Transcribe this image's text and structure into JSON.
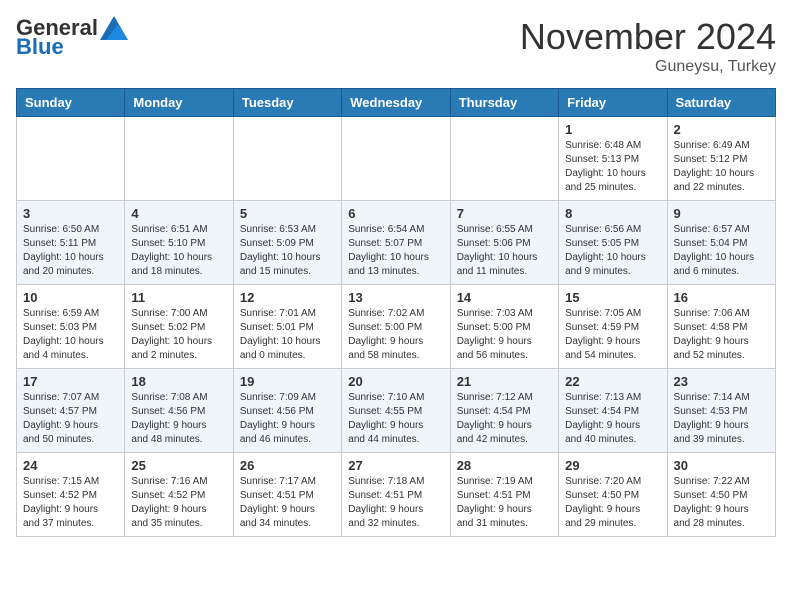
{
  "logo": {
    "general": "General",
    "blue": "Blue"
  },
  "header": {
    "title": "November 2024",
    "subtitle": "Guneysu, Turkey"
  },
  "weekdays": [
    "Sunday",
    "Monday",
    "Tuesday",
    "Wednesday",
    "Thursday",
    "Friday",
    "Saturday"
  ],
  "weeks": [
    [
      {
        "day": "",
        "info": ""
      },
      {
        "day": "",
        "info": ""
      },
      {
        "day": "",
        "info": ""
      },
      {
        "day": "",
        "info": ""
      },
      {
        "day": "",
        "info": ""
      },
      {
        "day": "1",
        "info": "Sunrise: 6:48 AM\nSunset: 5:13 PM\nDaylight: 10 hours\nand 25 minutes."
      },
      {
        "day": "2",
        "info": "Sunrise: 6:49 AM\nSunset: 5:12 PM\nDaylight: 10 hours\nand 22 minutes."
      }
    ],
    [
      {
        "day": "3",
        "info": "Sunrise: 6:50 AM\nSunset: 5:11 PM\nDaylight: 10 hours\nand 20 minutes."
      },
      {
        "day": "4",
        "info": "Sunrise: 6:51 AM\nSunset: 5:10 PM\nDaylight: 10 hours\nand 18 minutes."
      },
      {
        "day": "5",
        "info": "Sunrise: 6:53 AM\nSunset: 5:09 PM\nDaylight: 10 hours\nand 15 minutes."
      },
      {
        "day": "6",
        "info": "Sunrise: 6:54 AM\nSunset: 5:07 PM\nDaylight: 10 hours\nand 13 minutes."
      },
      {
        "day": "7",
        "info": "Sunrise: 6:55 AM\nSunset: 5:06 PM\nDaylight: 10 hours\nand 11 minutes."
      },
      {
        "day": "8",
        "info": "Sunrise: 6:56 AM\nSunset: 5:05 PM\nDaylight: 10 hours\nand 9 minutes."
      },
      {
        "day": "9",
        "info": "Sunrise: 6:57 AM\nSunset: 5:04 PM\nDaylight: 10 hours\nand 6 minutes."
      }
    ],
    [
      {
        "day": "10",
        "info": "Sunrise: 6:59 AM\nSunset: 5:03 PM\nDaylight: 10 hours\nand 4 minutes."
      },
      {
        "day": "11",
        "info": "Sunrise: 7:00 AM\nSunset: 5:02 PM\nDaylight: 10 hours\nand 2 minutes."
      },
      {
        "day": "12",
        "info": "Sunrise: 7:01 AM\nSunset: 5:01 PM\nDaylight: 10 hours\nand 0 minutes."
      },
      {
        "day": "13",
        "info": "Sunrise: 7:02 AM\nSunset: 5:00 PM\nDaylight: 9 hours\nand 58 minutes."
      },
      {
        "day": "14",
        "info": "Sunrise: 7:03 AM\nSunset: 5:00 PM\nDaylight: 9 hours\nand 56 minutes."
      },
      {
        "day": "15",
        "info": "Sunrise: 7:05 AM\nSunset: 4:59 PM\nDaylight: 9 hours\nand 54 minutes."
      },
      {
        "day": "16",
        "info": "Sunrise: 7:06 AM\nSunset: 4:58 PM\nDaylight: 9 hours\nand 52 minutes."
      }
    ],
    [
      {
        "day": "17",
        "info": "Sunrise: 7:07 AM\nSunset: 4:57 PM\nDaylight: 9 hours\nand 50 minutes."
      },
      {
        "day": "18",
        "info": "Sunrise: 7:08 AM\nSunset: 4:56 PM\nDaylight: 9 hours\nand 48 minutes."
      },
      {
        "day": "19",
        "info": "Sunrise: 7:09 AM\nSunset: 4:56 PM\nDaylight: 9 hours\nand 46 minutes."
      },
      {
        "day": "20",
        "info": "Sunrise: 7:10 AM\nSunset: 4:55 PM\nDaylight: 9 hours\nand 44 minutes."
      },
      {
        "day": "21",
        "info": "Sunrise: 7:12 AM\nSunset: 4:54 PM\nDaylight: 9 hours\nand 42 minutes."
      },
      {
        "day": "22",
        "info": "Sunrise: 7:13 AM\nSunset: 4:54 PM\nDaylight: 9 hours\nand 40 minutes."
      },
      {
        "day": "23",
        "info": "Sunrise: 7:14 AM\nSunset: 4:53 PM\nDaylight: 9 hours\nand 39 minutes."
      }
    ],
    [
      {
        "day": "24",
        "info": "Sunrise: 7:15 AM\nSunset: 4:52 PM\nDaylight: 9 hours\nand 37 minutes."
      },
      {
        "day": "25",
        "info": "Sunrise: 7:16 AM\nSunset: 4:52 PM\nDaylight: 9 hours\nand 35 minutes."
      },
      {
        "day": "26",
        "info": "Sunrise: 7:17 AM\nSunset: 4:51 PM\nDaylight: 9 hours\nand 34 minutes."
      },
      {
        "day": "27",
        "info": "Sunrise: 7:18 AM\nSunset: 4:51 PM\nDaylight: 9 hours\nand 32 minutes."
      },
      {
        "day": "28",
        "info": "Sunrise: 7:19 AM\nSunset: 4:51 PM\nDaylight: 9 hours\nand 31 minutes."
      },
      {
        "day": "29",
        "info": "Sunrise: 7:20 AM\nSunset: 4:50 PM\nDaylight: 9 hours\nand 29 minutes."
      },
      {
        "day": "30",
        "info": "Sunrise: 7:22 AM\nSunset: 4:50 PM\nDaylight: 9 hours\nand 28 minutes."
      }
    ]
  ]
}
